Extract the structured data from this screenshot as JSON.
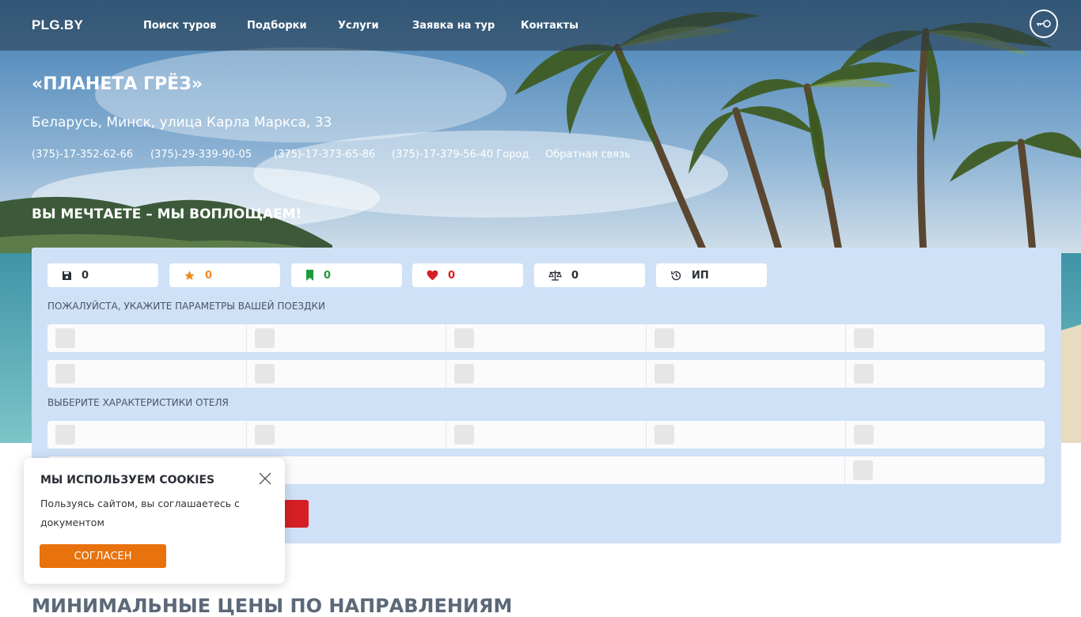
{
  "header": {
    "logo": "PLG.BY",
    "nav": [
      {
        "label": "Поиск туров"
      },
      {
        "label": "Подборки"
      },
      {
        "label": "Услуги"
      },
      {
        "label": "Заявка на тур"
      },
      {
        "label": "Контакты"
      }
    ]
  },
  "company": {
    "name": "«ПЛАНЕТА ГРЁЗ»",
    "address": "Беларусь, Минск, улица Карла Маркса, 33",
    "phones": [
      "(375)-17-352-62-66",
      "(375)-29-339-90-05",
      "(375)-17-373-65-86",
      "(375)-17-379-56-40 Город"
    ],
    "feedback": "Обратная связь"
  },
  "slogan": "ВЫ МЕЧТАЕТЕ – МЫ ВОПЛОЩАЕМ!",
  "search": {
    "counters": [
      {
        "icon": "floppy-disk-icon",
        "value": "0",
        "color": "#2a2f36"
      },
      {
        "icon": "star-icon",
        "value": "0",
        "color": "#f08a24"
      },
      {
        "icon": "bookmark-icon",
        "value": "0",
        "color": "#1e9b3c"
      },
      {
        "icon": "heart-icon",
        "value": "0",
        "color": "#d51f24"
      },
      {
        "icon": "scales-icon",
        "value": "0",
        "color": "#2a2f36"
      },
      {
        "icon": "history-icon",
        "value": "ИП",
        "color": "#2a2f36"
      }
    ],
    "trip_params_label": "ПОЖАЛУЙСТА, УКАЖИТЕ ПАРАМЕТРЫ ВАШЕЙ ПОЕЗДКИ",
    "hotel_params_label": "ВЫБЕРИТЕ ХАРАКТЕРИСТИКИ ОТЕЛЯ"
  },
  "cookies": {
    "title": "МЫ ИСПОЛЬЗУЕМ COOKIES",
    "text": "Пользуясь сайтом, вы соглашаетесь с документом",
    "accept_label": "СОГЛАСЕН"
  },
  "min_prices_heading": "МИНИМАЛЬНЫЕ ЦЕНЫ ПО НАПРАВЛЕНИЯМ"
}
